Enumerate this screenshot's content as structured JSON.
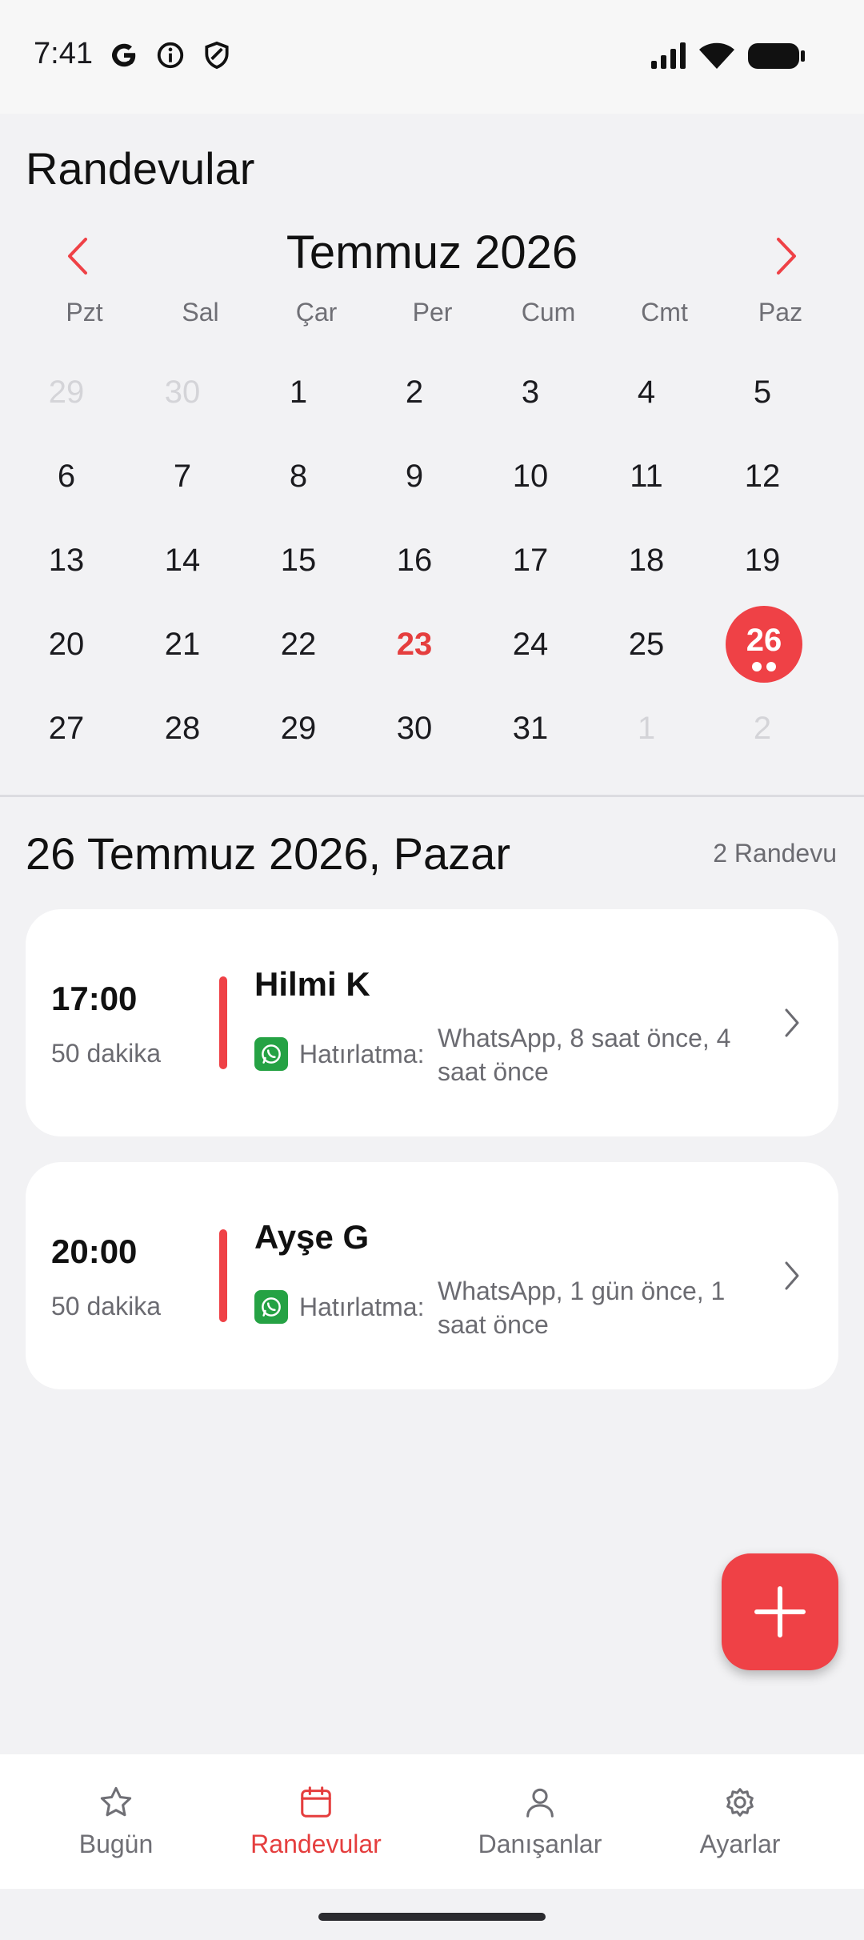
{
  "status_bar": {
    "time": "7:41",
    "icons": [
      "google-icon",
      "info-icon",
      "shield-icon",
      "signal-icon",
      "wifi-icon",
      "battery-icon"
    ]
  },
  "header": {
    "title": "Randevular"
  },
  "calendar": {
    "month_title": "Temmuz 2026",
    "weekdays": [
      "Pzt",
      "Sal",
      "Çar",
      "Per",
      "Cum",
      "Cmt",
      "Paz"
    ],
    "weeks": [
      [
        "29",
        "30",
        "1",
        "2",
        "3",
        "4",
        "5"
      ],
      [
        "6",
        "7",
        "8",
        "9",
        "10",
        "11",
        "12"
      ],
      [
        "13",
        "14",
        "15",
        "16",
        "17",
        "18",
        "19"
      ],
      [
        "20",
        "21",
        "22",
        "23",
        "24",
        "25",
        "26"
      ],
      [
        "27",
        "28",
        "29",
        "30",
        "31",
        "1",
        "2"
      ]
    ],
    "today": "23",
    "selected": "26",
    "accent_color": "#ef4146"
  },
  "day_view": {
    "date_heading": "26 Temmuz 2026, Pazar",
    "count": "2 Randevu",
    "appointments": [
      {
        "time": "17:00",
        "duration": "50 dakika",
        "name": "Hilmi K",
        "reminder_label": "Hatırlatma:",
        "reminder_value": "WhatsApp, 8 saat önce, 4 saat önce"
      },
      {
        "time": "20:00",
        "duration": "50 dakika",
        "name": "Ayşe G",
        "reminder_label": "Hatırlatma:",
        "reminder_value": "WhatsApp, 1 gün önce, 1 saat önce"
      }
    ]
  },
  "bottom_nav": {
    "items": [
      {
        "label": "Bugün",
        "icon": "star-icon"
      },
      {
        "label": "Randevular",
        "icon": "calendar-icon"
      },
      {
        "label": "Danışanlar",
        "icon": "person-icon"
      },
      {
        "label": "Ayarlar",
        "icon": "gear-icon"
      }
    ],
    "active": "Randevular"
  }
}
